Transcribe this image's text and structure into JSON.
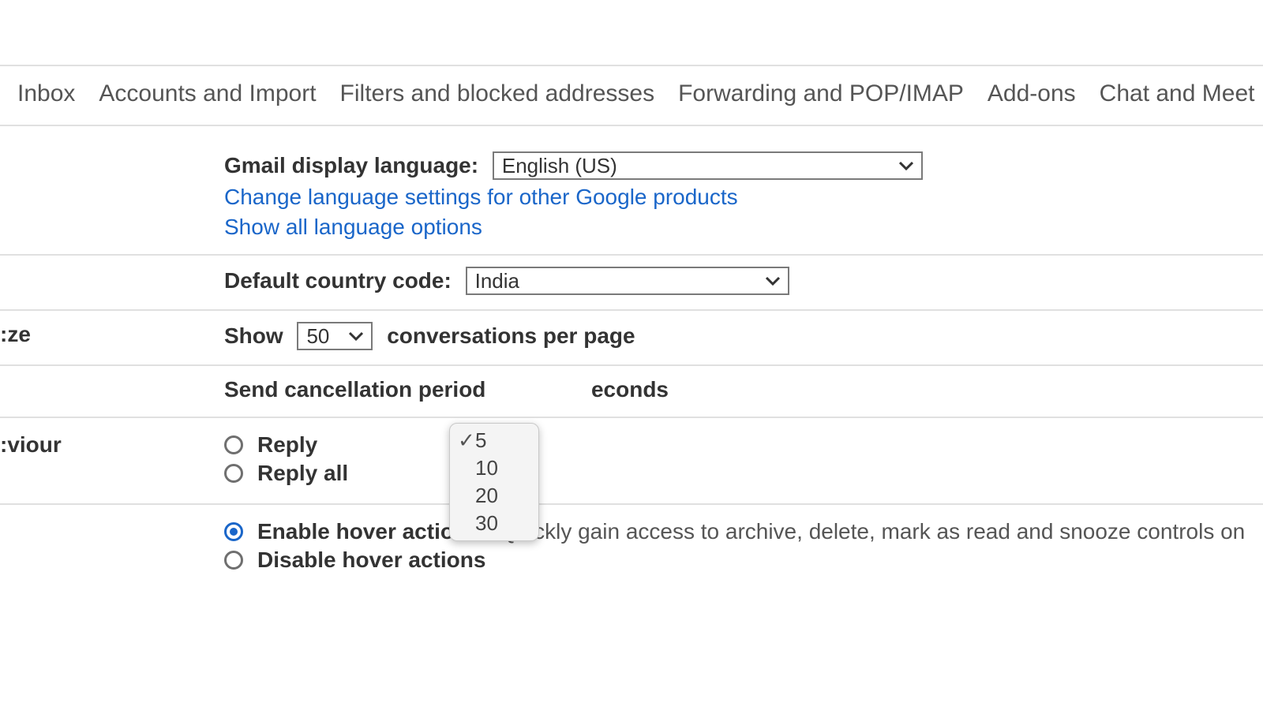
{
  "tabs": {
    "inbox": "Inbox",
    "accounts": "Accounts and Import",
    "filters": "Filters and blocked addresses",
    "forwarding": "Forwarding and POP/IMAP",
    "addons": "Add-ons",
    "chat": "Chat and Meet"
  },
  "labels_truncated": {
    "pagesize": "ze:",
    "behaviour": "viour:"
  },
  "language": {
    "label": "Gmail display language:",
    "value": "English (US)",
    "link_other": "Change language settings for other Google products",
    "link_all": "Show all language options"
  },
  "country": {
    "label": "Default country code:",
    "value": "India"
  },
  "pagesize": {
    "prefix": "Show",
    "value": "50",
    "suffix": "conversations per page"
  },
  "undo": {
    "prefix": "Send cancellation period",
    "suffix": "econds",
    "options": [
      "5",
      "10",
      "20",
      "30"
    ],
    "selected": "5"
  },
  "reply": {
    "opt1": "Reply",
    "opt2": "Reply all"
  },
  "hover": {
    "enable": "Enable hover actions",
    "enable_desc": " - Quickly gain access to archive, delete, mark as read and snooze controls on",
    "disable": "Disable hover actions"
  }
}
